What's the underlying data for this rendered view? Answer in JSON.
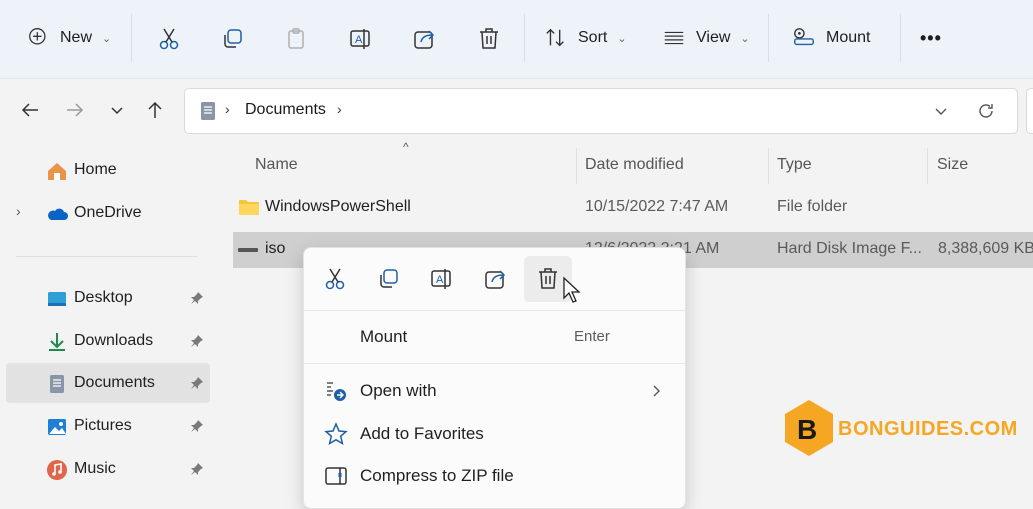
{
  "toolbar": {
    "new_label": "New",
    "sort_label": "Sort",
    "view_label": "View",
    "mount_label": "Mount",
    "more_label": "•••",
    "accent": "#0067c0"
  },
  "address": {
    "breadcrumb": "Documents"
  },
  "sidebar": {
    "items": [
      {
        "label": "Home",
        "icon": "home-icon"
      },
      {
        "label": "OneDrive",
        "icon": "onedrive-icon"
      },
      {
        "label": "Desktop",
        "icon": "desktop-icon"
      },
      {
        "label": "Downloads",
        "icon": "downloads-icon"
      },
      {
        "label": "Documents",
        "icon": "documents-icon"
      },
      {
        "label": "Pictures",
        "icon": "pictures-icon"
      },
      {
        "label": "Music",
        "icon": "music-icon"
      }
    ]
  },
  "columns": {
    "name": "Name",
    "date": "Date modified",
    "type": "Type",
    "size": "Size"
  },
  "files": [
    {
      "name": "WindowsPowerShell",
      "date": "10/15/2022 7:47 AM",
      "type": "File folder",
      "size": ""
    },
    {
      "name": "iso",
      "date": "12/6/2022 2:21 AM",
      "type": "Hard Disk Image F...",
      "size": "8,388,609 KB"
    }
  ],
  "context_menu": {
    "items": [
      {
        "label": "Mount",
        "accel": "Enter",
        "icon": ""
      },
      {
        "label": "Open with",
        "accel": "",
        "icon": "open-with-icon"
      },
      {
        "label": "Add to Favorites",
        "accel": "",
        "icon": "star-icon"
      },
      {
        "label": "Compress to ZIP file",
        "accel": "",
        "icon": "zip-icon"
      }
    ]
  },
  "watermark": {
    "text": "BONGUIDES.COM",
    "letter": "B",
    "color": "#f5a623"
  }
}
